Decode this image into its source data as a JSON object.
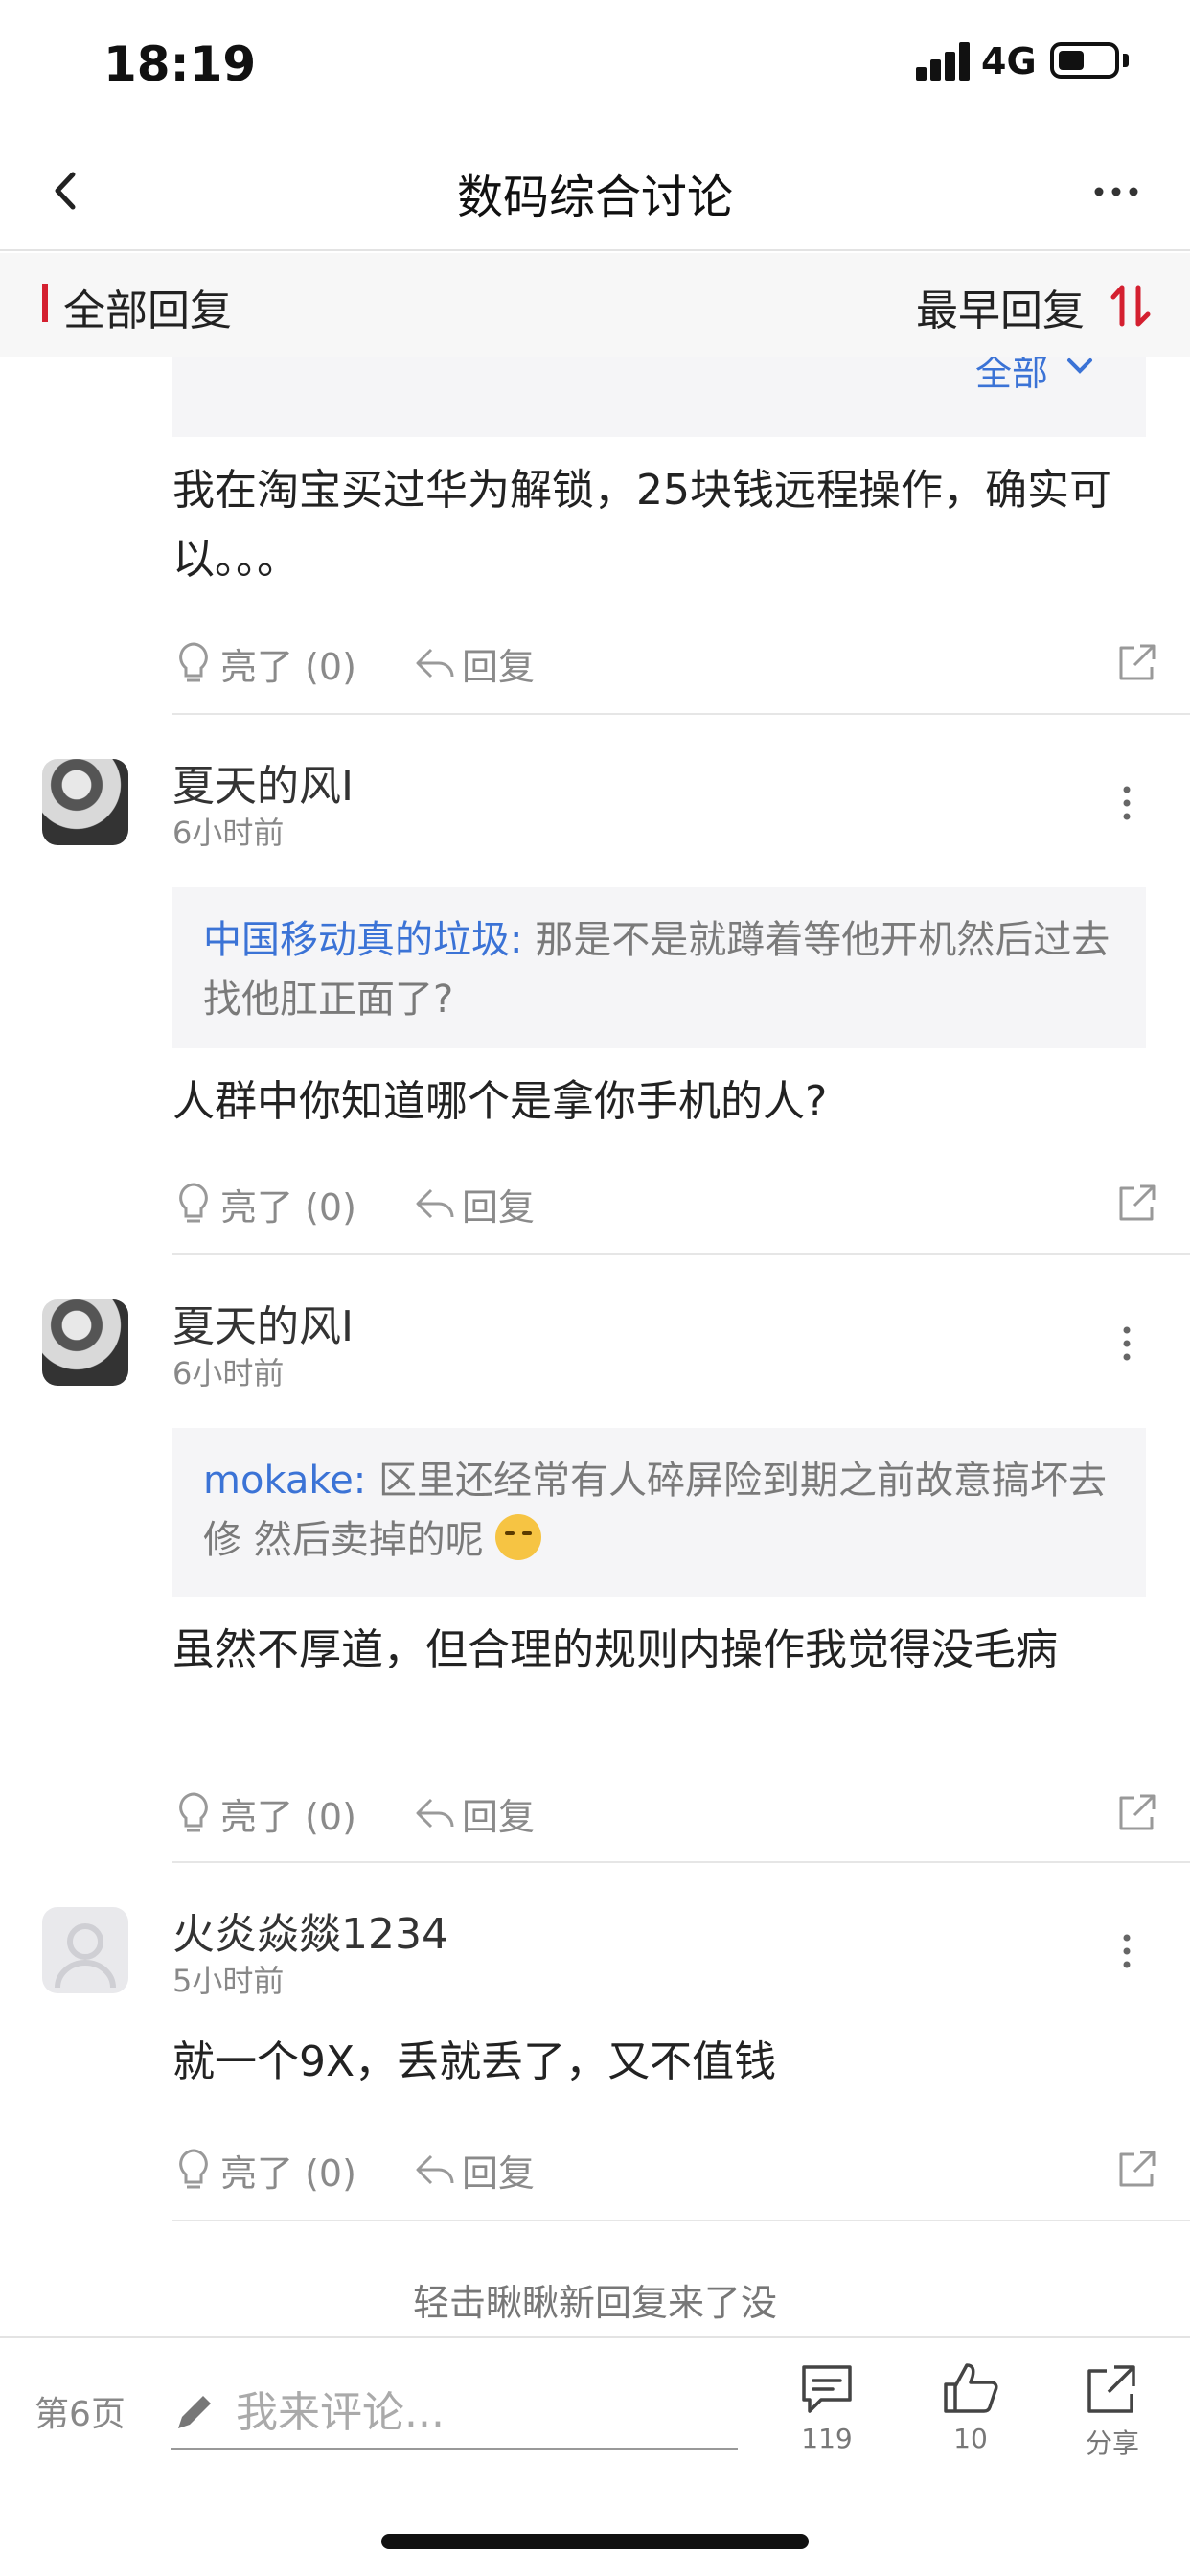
{
  "status_bar": {
    "time": "18:19",
    "network": "4G",
    "icons": [
      "signal-icon",
      "battery-icon"
    ]
  },
  "nav": {
    "title": "数码综合讨论",
    "back_icon": "chevron-left-icon",
    "more_icon": "more-horizontal-icon"
  },
  "filter": {
    "left_label": "全部回复",
    "right_label": "最早回复",
    "sort_icon": "sort-arrows-icon",
    "accent_color": "#d42030"
  },
  "feed": {
    "expand_label": "全部",
    "first_post": {
      "body": "我在淘宝买过华为解锁，25块钱远程操作，确实可以。。。",
      "light_label": "亮了 (0)",
      "reply_label": "回复"
    },
    "posts": [
      {
        "user": "夏天的风I",
        "time": "6小时前",
        "quote_user": "中国移动真的垃圾:",
        "quote_text": "那是不是就蹲着等他开机然后过去找他肛正面了?",
        "body": "人群中你知道哪个是拿你手机的人?",
        "light_label": "亮了 (0)",
        "reply_label": "回复"
      },
      {
        "user": "夏天的风I",
        "time": "6小时前",
        "quote_user": "mokake:",
        "quote_text": "区里还经常有人碎屏险到期之前故意搞坏去修 然后卖掉的呢",
        "body": "虽然不厚道，但合理的规则内操作我觉得没毛病",
        "light_label": "亮了 (0)",
        "reply_label": "回复"
      },
      {
        "user": "火炎焱燚1234",
        "time": "5小时前",
        "body": "就一个9X，丢就丢了，又不值钱",
        "light_label": "亮了 (0)",
        "reply_label": "回复"
      }
    ],
    "load_more": "轻击瞅瞅新回复来了没",
    "link_color": "#3b73d6"
  },
  "bottom_bar": {
    "page_label": "第6页",
    "input_placeholder": "我来评论...",
    "comments_count": "119",
    "likes_count": "10",
    "share_label": "分享"
  }
}
